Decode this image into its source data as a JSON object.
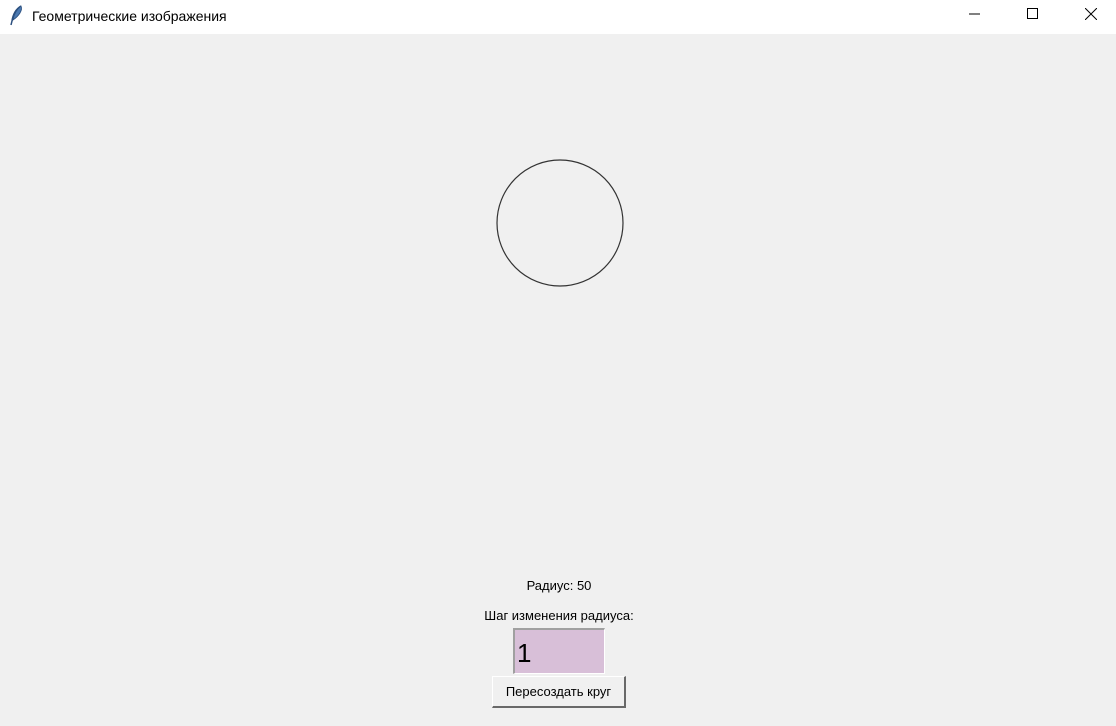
{
  "window": {
    "title": "Геометрические изображения",
    "app_icon": "feather-icon",
    "controls": [
      "minimize-icon",
      "maximize-icon",
      "close-icon"
    ]
  },
  "canvas": {
    "shape": "circle",
    "radius": 50
  },
  "controls": {
    "radius_label": "Радиус: 50",
    "step_label": "Шаг изменения радиуса:",
    "step_value": "1",
    "step_input_bg": "#d8bfd8",
    "recreate_button": "Пересоздать круг"
  }
}
